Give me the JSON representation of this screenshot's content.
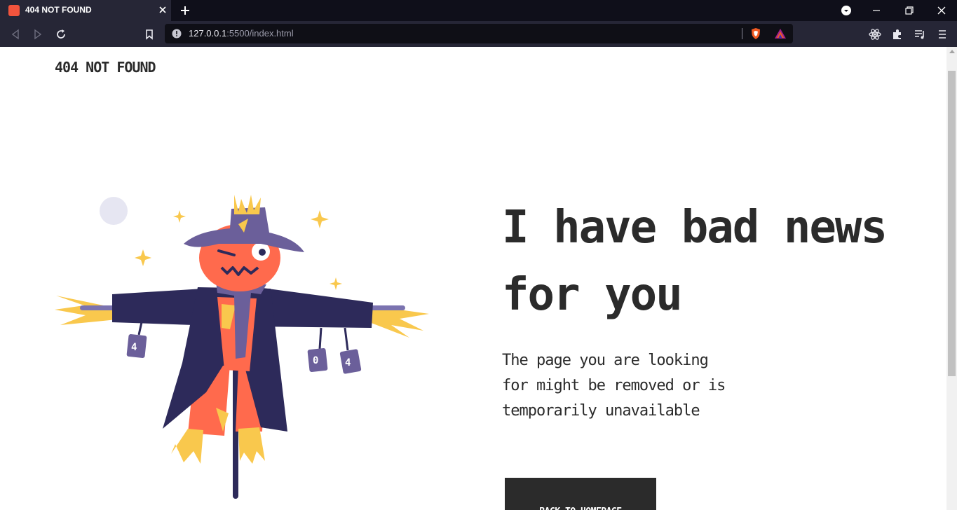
{
  "browser": {
    "tab_title": "404 NOT FOUND",
    "url_host": "127.0.0.1",
    "url_path": ":5500/index.html"
  },
  "page": {
    "logo": "404 NOT FOUND",
    "headline_line1": "I have bad news",
    "headline_line2": "for you",
    "description_line1": "The page you are looking",
    "description_line2": "for might be removed or is",
    "description_line3": "temporarily unavailable",
    "button_label": "BACK TO HOMEPAGE"
  },
  "illustration": {
    "subject": "scarecrow",
    "can_labels": [
      "4",
      "0",
      "4"
    ]
  },
  "colors": {
    "chrome_dark": "#0f0f1a",
    "chrome_mid": "#262636",
    "text": "#2b2b2b",
    "button_bg": "#2b2b2b",
    "button_text": "#ffffff",
    "scarecrow_body": "#ff6a4d",
    "coat": "#2d2a5a",
    "hat": "#6b5f9a",
    "straw": "#f9c84d",
    "moon": "#e6e6f2"
  }
}
